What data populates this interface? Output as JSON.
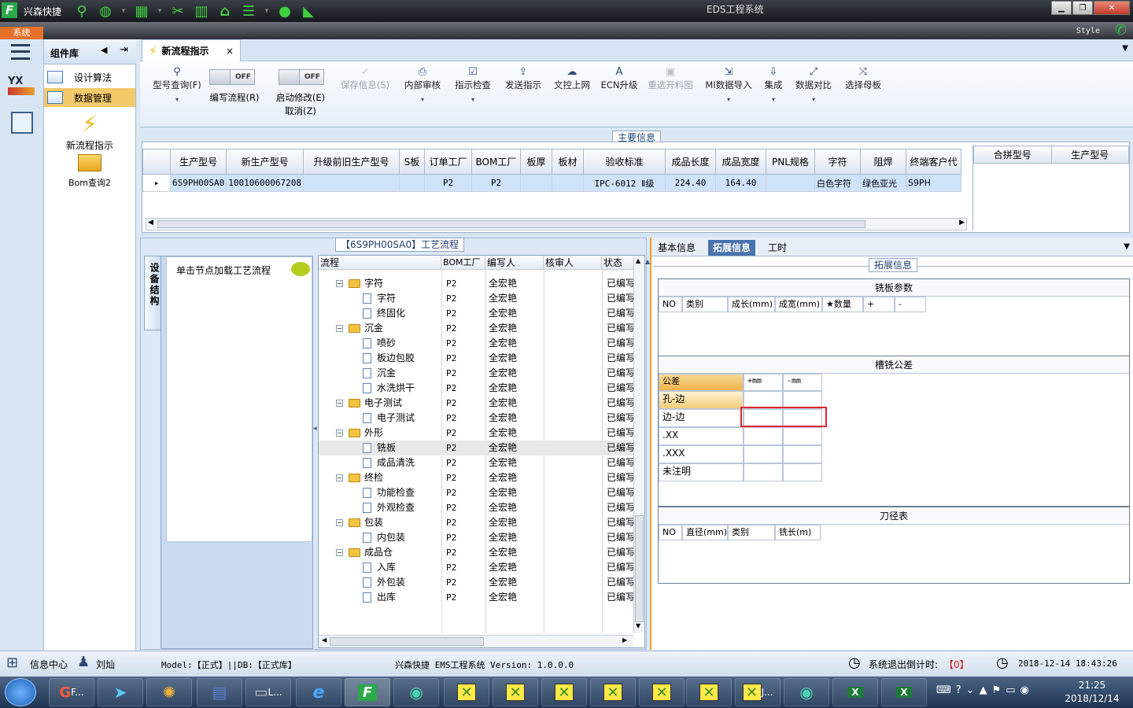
{
  "title_bar": {
    "quick_label": "兴森快捷",
    "window_title": "EDS工程系统"
  },
  "ribbon": {
    "system_tab": "系统",
    "style_label": "Style"
  },
  "left_panel": {
    "header": "组件库",
    "items": [
      {
        "label": "设计算法"
      },
      {
        "label": "数据管理"
      }
    ],
    "tool_items": [
      {
        "label": "新流程指示"
      },
      {
        "label": "Bom查询2"
      }
    ]
  },
  "doc_tab": {
    "label": "新流程指示",
    "close": "×"
  },
  "toolbar": {
    "model_query": "型号查询(F)",
    "edit_flow": "编写流程(R)",
    "start_modify": "启动修改(E)",
    "cancel": "取消(Z)",
    "toggle_off": "OFF",
    "save_info": "保存信息(S)",
    "internal_review": "内部审核",
    "instruction_check": "指示检查",
    "send_instruction": "发送指示",
    "doc_upload": "文控上网",
    "ecn_upgrade": "ECN升级",
    "reselect_image": "重选开料图",
    "mi_import": "MI数据导入",
    "integrate": "集成",
    "data_compare": "数据对比",
    "select_master": "选择母板"
  },
  "main_info": {
    "title": "主要信息",
    "columns": [
      "生产型号",
      "新生产型号",
      "升级前旧生产型号",
      "S板",
      "订单工厂",
      "BOM工厂",
      "板厚",
      "板材",
      "验收标准",
      "成品长度",
      "成品宽度",
      "PNL规格",
      "字符",
      "阻焊",
      "终端客户代"
    ],
    "row": [
      "6S9PH00SA0",
      "10010600067208",
      "",
      "",
      "P2",
      "P2",
      "",
      "",
      "IPC-6012 Ⅱ级",
      "224.40",
      "164.40",
      "",
      "白色字符",
      "绿色亚光",
      "S9PH"
    ],
    "side_columns": [
      "合拼型号",
      "生产型号"
    ]
  },
  "process": {
    "title": "【6S9PH00SA0】工艺流程",
    "side_tab": "设备结构",
    "node_hint": "单击节点加载工艺流程",
    "columns": [
      "流程",
      "BOM工厂",
      "编写人",
      "核审人",
      "状态"
    ],
    "rows": [
      {
        "name": "字符",
        "type": "folder",
        "bom": "P2",
        "writer": "全宏艳",
        "status": "已编写"
      },
      {
        "name": "字符",
        "type": "file",
        "bom": "P2",
        "writer": "全宏艳",
        "status": "已编写"
      },
      {
        "name": "终固化",
        "type": "file",
        "bom": "P2",
        "writer": "全宏艳",
        "status": "已编写"
      },
      {
        "name": "沉金",
        "type": "folder",
        "bom": "P2",
        "writer": "全宏艳",
        "status": "已编写"
      },
      {
        "name": "喷砂",
        "type": "file",
        "bom": "P2",
        "writer": "全宏艳",
        "status": "已编写"
      },
      {
        "name": "板边包胶",
        "type": "file",
        "bom": "P2",
        "writer": "全宏艳",
        "status": "已编写"
      },
      {
        "name": "沉金",
        "type": "file",
        "bom": "P2",
        "writer": "全宏艳",
        "status": "已编写"
      },
      {
        "name": "水洗烘干",
        "type": "file",
        "bom": "P2",
        "writer": "全宏艳",
        "status": "已编写"
      },
      {
        "name": "电子测试",
        "type": "folder",
        "bom": "P2",
        "writer": "全宏艳",
        "status": "已编写"
      },
      {
        "name": "电子测试",
        "type": "file",
        "bom": "P2",
        "writer": "全宏艳",
        "status": "已编写"
      },
      {
        "name": "外形",
        "type": "folder",
        "bom": "P2",
        "writer": "全宏艳",
        "status": "已编写"
      },
      {
        "name": "铣板",
        "type": "file",
        "bom": "P2",
        "writer": "全宏艳",
        "status": "已编写",
        "selected": true
      },
      {
        "name": "成品清洗",
        "type": "file",
        "bom": "P2",
        "writer": "全宏艳",
        "status": "已编写"
      },
      {
        "name": "终检",
        "type": "folder",
        "bom": "P2",
        "writer": "全宏艳",
        "status": "已编写"
      },
      {
        "name": "功能检查",
        "type": "file",
        "bom": "P2",
        "writer": "全宏艳",
        "status": "已编写"
      },
      {
        "name": "外观检查",
        "type": "file",
        "bom": "P2",
        "writer": "全宏艳",
        "status": "已编写"
      },
      {
        "name": "包装",
        "type": "folder",
        "bom": "P2",
        "writer": "全宏艳",
        "status": "已编写"
      },
      {
        "name": "内包装",
        "type": "file",
        "bom": "P2",
        "writer": "全宏艳",
        "status": "已编写"
      },
      {
        "name": "成品仓",
        "type": "folder",
        "bom": "P2",
        "writer": "全宏艳",
        "status": "已编写"
      },
      {
        "name": "入库",
        "type": "file",
        "bom": "P2",
        "writer": "全宏艳",
        "status": "已编写"
      },
      {
        "name": "外包装",
        "type": "file",
        "bom": "P2",
        "writer": "全宏艳",
        "status": "已编写"
      },
      {
        "name": "出库",
        "type": "file",
        "bom": "P2",
        "writer": "全宏艳",
        "status": "已编写"
      }
    ]
  },
  "right_panel": {
    "tabs": [
      "基本信息",
      "拓展信息",
      "工时"
    ],
    "section_title": "拓展信息",
    "milling_params": {
      "title": "铣板参数",
      "columns": [
        "NO",
        "类别",
        "成长(mm)",
        "成宽(mm)",
        "★数量",
        "+",
        "-"
      ]
    },
    "tolerance": {
      "title": "槽铣公差",
      "header": [
        "公差",
        "+mm",
        "-mm"
      ],
      "rows": [
        "孔-边",
        "边-边",
        ".XX",
        ".XXX",
        "未注明"
      ]
    },
    "tool_table": {
      "title": "刀径表",
      "columns": [
        "NO",
        "直径(mm)",
        "类别",
        "铣长(m)"
      ]
    }
  },
  "status_bar": {
    "info_center": "信息中心",
    "user": "刘灿",
    "model": "Model:【正式】||DB:【正式库】",
    "app": "兴森快捷 EMS工程系统 Version: 1.0.0.0",
    "countdown_label": "系统退出倒计时:",
    "countdown_value": "【0】",
    "datetime": "2018-12-14 18:43:26"
  },
  "taskbar": {
    "time": "21:25",
    "date": "2018/12/14",
    "f_label": "F...",
    "l_label": "L...",
    "j_label": "J..."
  }
}
